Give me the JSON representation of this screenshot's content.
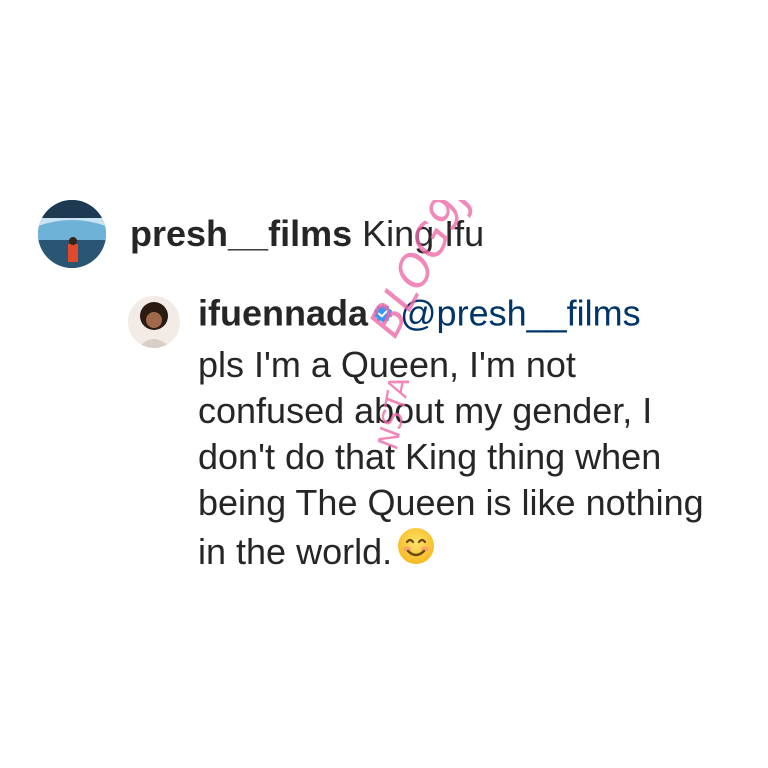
{
  "comment": {
    "username": "presh__films",
    "text": "King Ifu"
  },
  "reply": {
    "username": "ifuennada",
    "mention": "@presh__films",
    "text": "pls I'm a Queen, I'm not confused about my gender, I don't do that King thing when being The Queen is like nothing in the world.",
    "emoji": "smiling-face-icon"
  },
  "watermark": {
    "text_line1": "BLOG9JA",
    "text_line2": "NSTA",
    "color": "#f06aa8"
  },
  "colors": {
    "text": "#262626",
    "mention": "#003569",
    "verified": "#3897f0"
  }
}
